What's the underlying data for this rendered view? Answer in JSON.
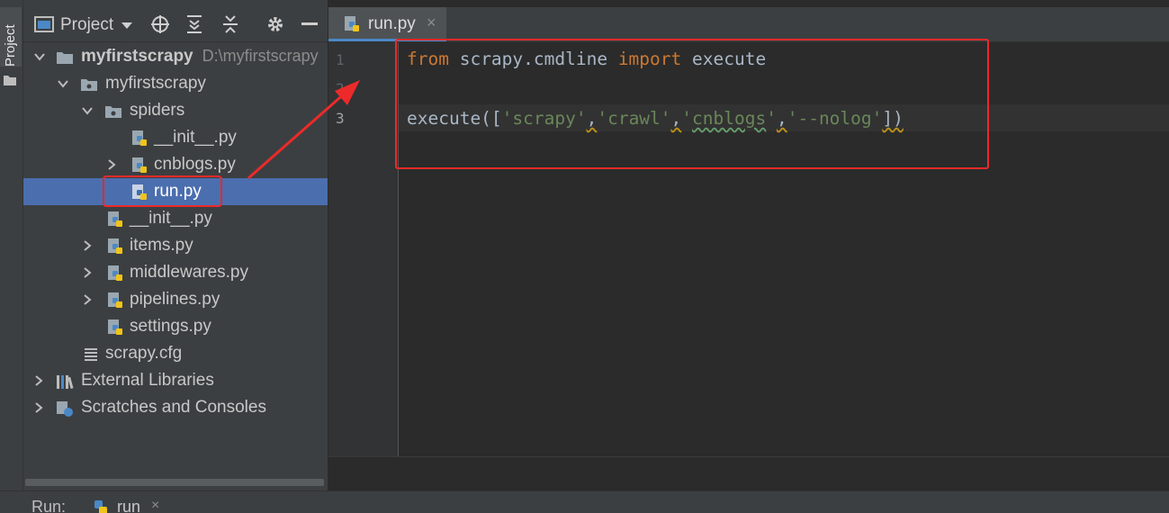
{
  "stripe": {
    "project_label": "Project"
  },
  "project_panel": {
    "title": "Project",
    "tree": [
      {
        "label": "myfirstscrapy",
        "path": "D:\\myfirstscrapy",
        "type": "folder",
        "expanded": true
      },
      {
        "label": "myfirstscrapy",
        "type": "package",
        "expanded": true
      },
      {
        "label": "spiders",
        "type": "package",
        "expanded": true
      },
      {
        "label": "__init__.py",
        "type": "python"
      },
      {
        "label": "cnblogs.py",
        "type": "python",
        "expanded": false
      },
      {
        "label": "run.py",
        "type": "python",
        "selected": true
      },
      {
        "label": "__init__.py",
        "type": "python"
      },
      {
        "label": "items.py",
        "type": "python",
        "expanded": false
      },
      {
        "label": "middlewares.py",
        "type": "python",
        "expanded": false
      },
      {
        "label": "pipelines.py",
        "type": "python",
        "expanded": false
      },
      {
        "label": "settings.py",
        "type": "python"
      },
      {
        "label": "scrapy.cfg",
        "type": "config"
      },
      {
        "label": "External Libraries",
        "type": "libraries",
        "expanded": false
      },
      {
        "label": "Scratches and Consoles",
        "type": "scratches",
        "expanded": false
      }
    ]
  },
  "editor": {
    "tab": {
      "label": "run.py",
      "close": "×"
    },
    "line_numbers": [
      "1",
      "2",
      "3"
    ],
    "code": {
      "line1": {
        "kw_from": "from",
        "module": " scrapy.cmdline ",
        "kw_import": "import",
        "name": " execute"
      },
      "line3": {
        "call": "execute([",
        "arg1": "'scrapy'",
        "comma1": ",",
        "arg2": "'crawl'",
        "comma2": ",",
        "arg3_pre": "'",
        "arg3_word": "cnblogs",
        "arg3_post": "'",
        "comma3": ",",
        "arg4": "'--nolog'",
        "end": "])"
      }
    }
  },
  "run_bar": {
    "label": "Run:",
    "tab_label": "run",
    "close": "×"
  },
  "colors": {
    "accent": "#4a88c7",
    "selection": "#4b6eaf",
    "keyword": "#cc7832",
    "string": "#6a8759",
    "annotation": "#ec2a2a"
  }
}
